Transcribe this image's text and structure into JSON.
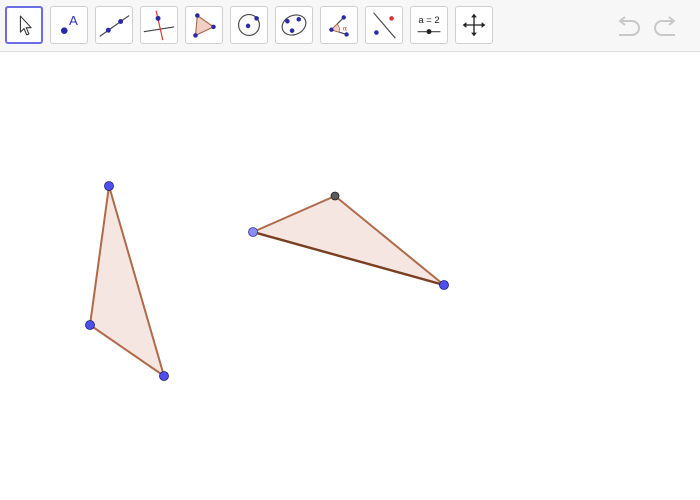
{
  "toolbar": {
    "tools": [
      {
        "name": "move-tool"
      },
      {
        "name": "point-tool"
      },
      {
        "name": "line-tool"
      },
      {
        "name": "perpendicular-line-tool"
      },
      {
        "name": "polygon-tool"
      },
      {
        "name": "circle-center-point-tool"
      },
      {
        "name": "conic-tool"
      },
      {
        "name": "angle-tool"
      },
      {
        "name": "reflect-about-line-tool"
      },
      {
        "name": "slider-tool",
        "label": "a = 2"
      },
      {
        "name": "move-graphics-view-tool"
      }
    ],
    "selected_tool": "move-tool",
    "undo_enabled": false,
    "redo_enabled": false
  },
  "colors": {
    "selected_border": "#6c6ce6",
    "polygon_stroke": "#b0694a",
    "polygon_fill": "#f5e6e1",
    "point_fill": "#4f4fef",
    "point_dark": "#5a5a5a",
    "point_light": "#8a8cf4"
  }
}
